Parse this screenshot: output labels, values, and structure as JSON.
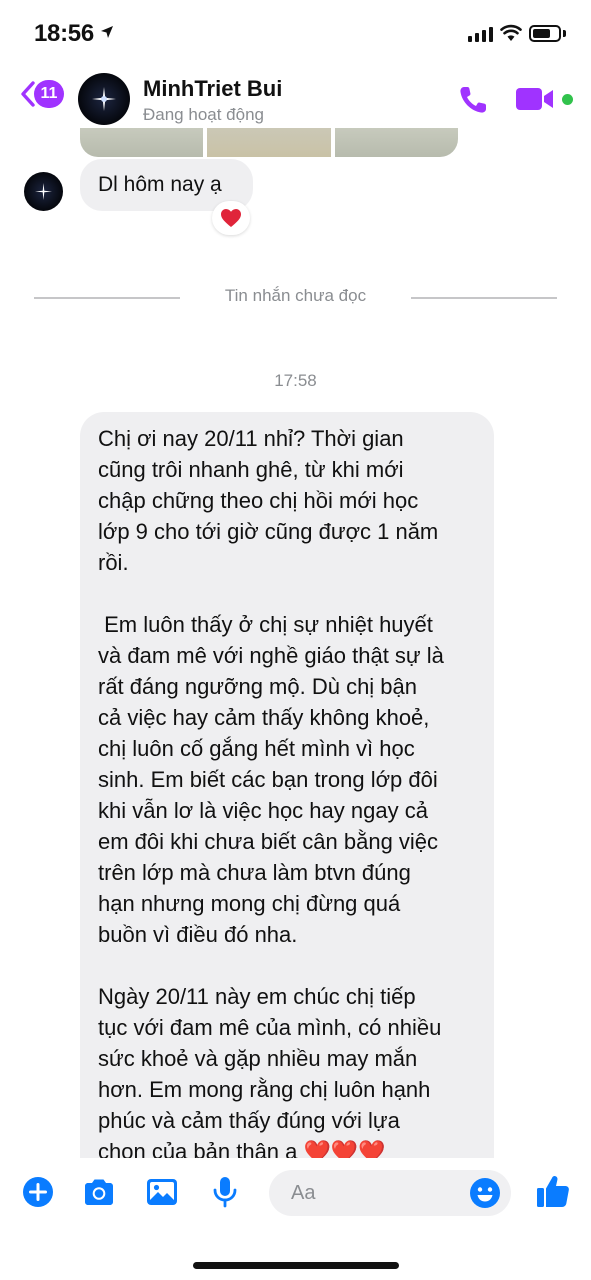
{
  "status_bar": {
    "time": "18:56"
  },
  "header": {
    "back_badge": "11",
    "contact_name": "MinhTriet Bui",
    "contact_status": "Đang hoạt động",
    "online_color": "#31c24c",
    "accent_color": "#a033ff"
  },
  "chat": {
    "short_message": "Dl hôm nay ạ",
    "reaction": "❤️",
    "unread_divider": "Tin nhắn chưa đọc",
    "timestamp": "17:58",
    "long_message": {
      "paragraph_1": "Chị ơi nay 20/11 nhỉ? Thời gian\ncũng trôi nhanh ghê, từ khi mới\nchập chững theo chị hồi mới học\nlớp 9 cho tới giờ cũng được 1 năm\nrồi.",
      "paragraph_2": " Em luôn thấy ở chị sự nhiệt huyết\nvà đam mê với nghề giáo thật sự là\nrất đáng ngưỡng mộ. Dù chị bận\ncả việc hay cảm thấy không khoẻ,\nchị luôn cố gắng hết mình vì học\nsinh. Em biết các bạn trong lớp đôi\nkhi vẫn lơ là việc học hay ngay cả\nem đôi khi chưa biết cân bằng việc\ntrên lớp mà chưa làm btvn đúng\nhạn nhưng mong chị đừng quá\nbuồn vì điều đó nha.",
      "paragraph_3": "Ngày 20/11 này em chúc chị tiếp\ntục với đam mê của mình, có nhiều\nsức khoẻ và gặp nhiều may mắn\nhơn. Em mong rằng chị luôn hạnh\nphúc và cảm thấy đúng với lựa\nchọn của bản thân ạ ",
      "hearts": "❤️❤️❤️"
    }
  },
  "composer": {
    "placeholder": "Aa",
    "icon_color": "#0a7cff"
  },
  "icons": {
    "back": "chevron-left-icon",
    "call": "phone-icon",
    "video": "video-camera-icon",
    "add": "plus-circle-icon",
    "camera": "camera-icon",
    "gallery": "image-icon",
    "mic": "microphone-icon",
    "emoji": "smiley-icon",
    "like": "thumbs-up-icon"
  }
}
